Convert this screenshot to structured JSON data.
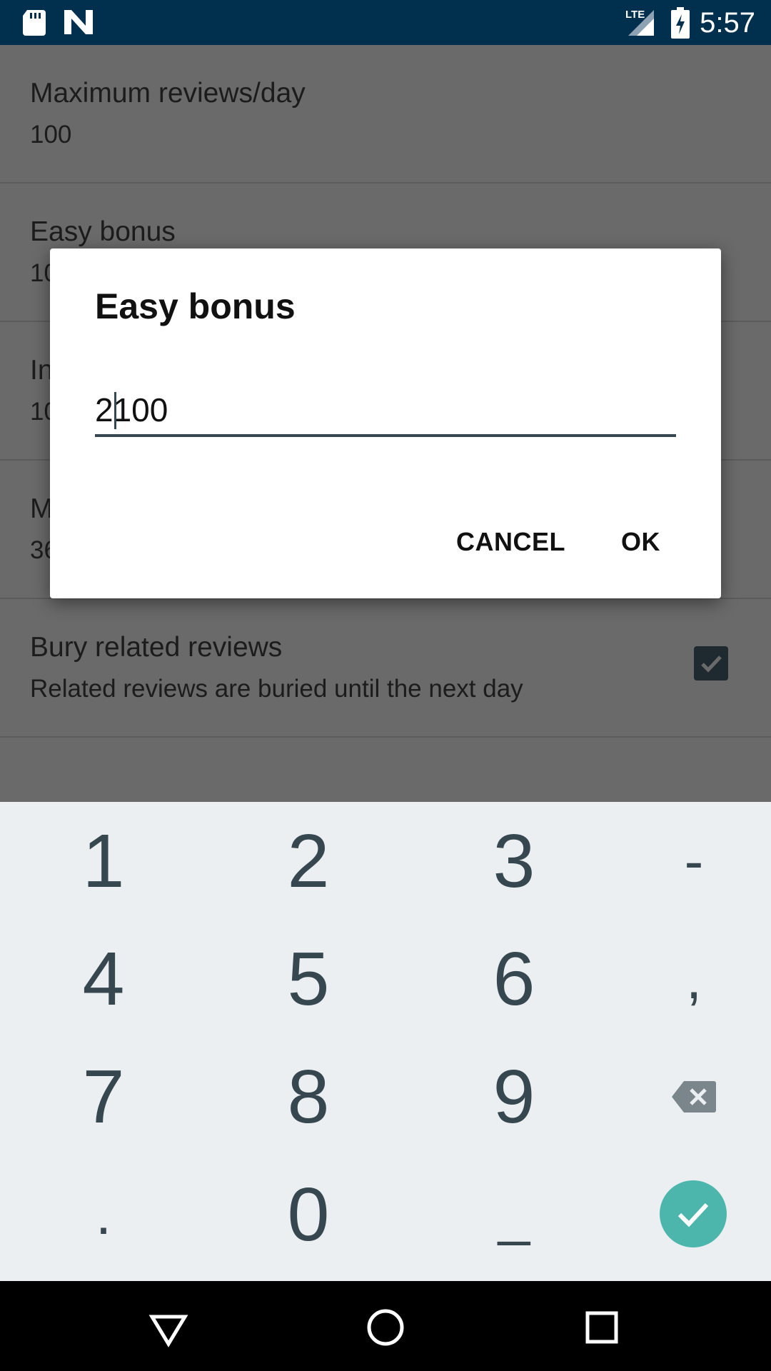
{
  "status_bar": {
    "time": "5:57",
    "network_label": "LTE",
    "icons": [
      "sd-card-icon",
      "n-logo-icon",
      "lte-signal-icon",
      "battery-charging-icon"
    ]
  },
  "settings": {
    "items": [
      {
        "title": "Maximum reviews/day",
        "summary": "100"
      },
      {
        "title": "Easy bonus",
        "summary": "10"
      },
      {
        "title": "In",
        "summary": "10"
      },
      {
        "title": "M",
        "summary": "36"
      },
      {
        "title": "Bury related reviews",
        "summary": "Related reviews are buried until the next day",
        "checked": true
      }
    ]
  },
  "dialog": {
    "title": "Easy bonus",
    "input_value": "2100",
    "cancel_label": "CANCEL",
    "ok_label": "OK"
  },
  "keyboard": {
    "keys": [
      "1",
      "2",
      "3",
      "-",
      "4",
      "5",
      "6",
      ",",
      "7",
      "8",
      "9",
      ".",
      "0",
      "_"
    ],
    "accent_color": "#4db6ac",
    "special_keys": [
      "backspace-icon",
      "done-check-icon"
    ]
  },
  "nav_bar": {
    "icons": [
      "back-triangle-icon",
      "home-circle-icon",
      "recents-square-icon"
    ]
  },
  "colors": {
    "status_bar": "#00304d",
    "scrim_background": "#6a6a6a",
    "keyboard_background": "#eceff1",
    "key_text": "#37474f"
  }
}
